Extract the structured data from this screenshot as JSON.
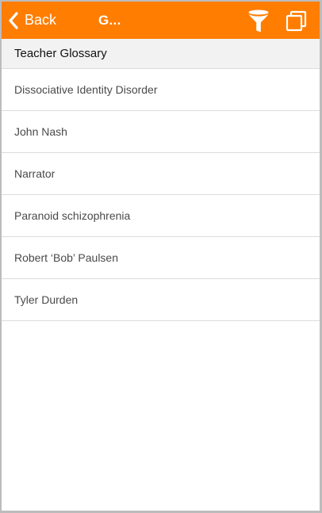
{
  "navbar": {
    "back_label": "Back",
    "title": "G...",
    "actions": [
      {
        "icon": "filter-icon"
      },
      {
        "icon": "copy-icon"
      }
    ],
    "color": "#ff7d00"
  },
  "section": {
    "title": "Teacher Glossary"
  },
  "items": [
    {
      "label": "Dissociative Identity Disorder"
    },
    {
      "label": "John Nash"
    },
    {
      "label": "Narrator"
    },
    {
      "label": "Paranoid schizophrenia"
    },
    {
      "label": "Robert ‘Bob’ Paulsen"
    },
    {
      "label": "Tyler Durden"
    }
  ]
}
